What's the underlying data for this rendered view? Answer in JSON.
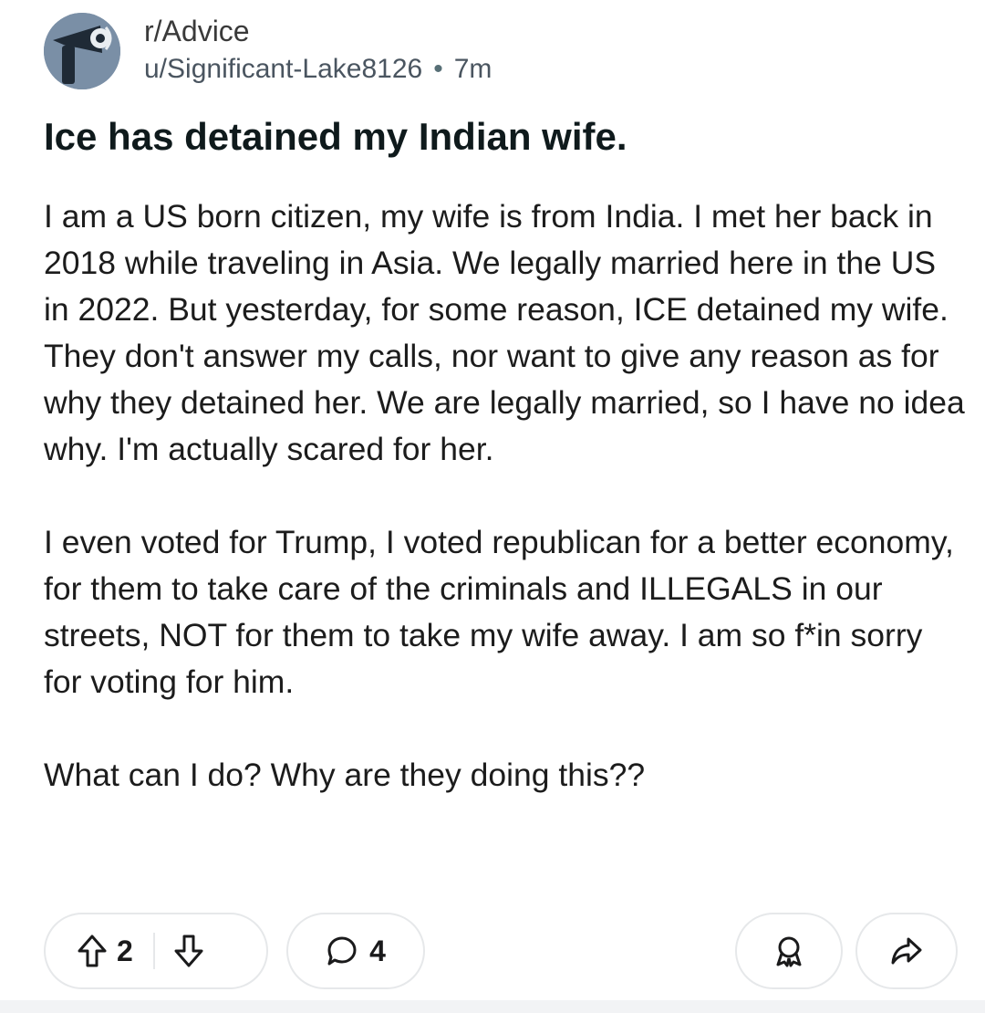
{
  "post": {
    "subreddit": "r/Advice",
    "author": "u/Significant-Lake8126",
    "separator": "•",
    "age": "7m",
    "title": "Ice has detained my Indian wife.",
    "paragraphs": [
      "I am a US born citizen, my wife is from India. I met her back in 2018 while traveling in Asia. We legally married here in the US in 2022. But yesterday, for some reason, ICE detained my wife. They don't answer my calls, nor want to give any reason as for why they detained her. We are legally married, so I have no idea why. I'm actually scared for her.",
      "I even voted for Trump, I voted republican for a better economy, for them to take care of the criminals and ILLEGALS in our streets, NOT for them to take my wife away. I am so f*in sorry for voting for him.",
      "What can I do? Why are they doing this??"
    ]
  },
  "actions": {
    "upvotes": "2",
    "comments": "4",
    "icons": {
      "upvote": "upvote-arrow-icon",
      "downvote": "downvote-arrow-icon",
      "comment": "comment-bubble-icon",
      "award": "award-icon",
      "share": "share-arrow-icon"
    }
  },
  "colors": {
    "avatar_bg": "#7a8fa6",
    "pill_border": "#e6e8ea",
    "text": "#1a1a1b"
  }
}
